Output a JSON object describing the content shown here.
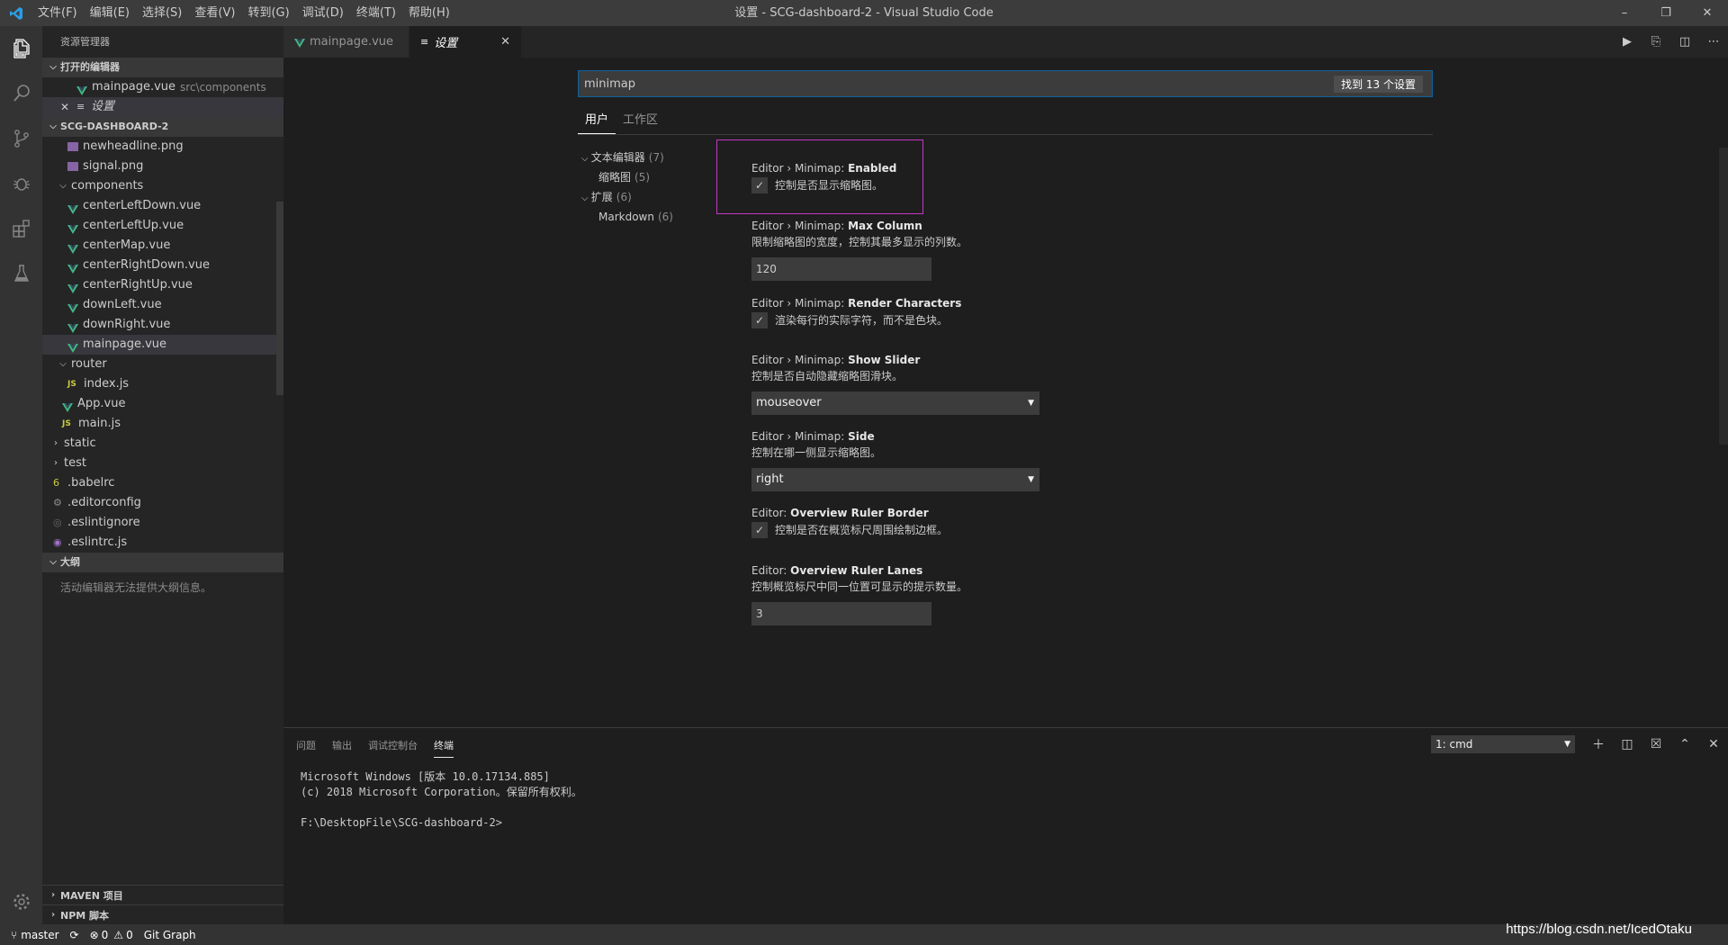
{
  "window": {
    "title": "设置 - SCG-dashboard-2 - Visual Studio Code",
    "menu": [
      "文件(F)",
      "编辑(E)",
      "选择(S)",
      "查看(V)",
      "转到(G)",
      "调试(D)",
      "终端(T)",
      "帮助(H)"
    ]
  },
  "sidebar": {
    "title": "资源管理器",
    "open_editors_title": "打开的编辑器",
    "open_editors": [
      {
        "name": "mainpage.vue",
        "desc": "src\\components"
      },
      {
        "name": "设置",
        "desc": ""
      }
    ],
    "project_title": "SCG-DASHBOARD-2",
    "files": [
      {
        "name": "newheadline.png",
        "type": "png",
        "indent": 2
      },
      {
        "name": "signal.png",
        "type": "png",
        "indent": 2
      },
      {
        "name": "components",
        "type": "folder-open",
        "indent": 1
      },
      {
        "name": "centerLeftDown.vue",
        "type": "vue",
        "indent": 2
      },
      {
        "name": "centerLeftUp.vue",
        "type": "vue",
        "indent": 2
      },
      {
        "name": "centerMap.vue",
        "type": "vue",
        "indent": 2
      },
      {
        "name": "centerRightDown.vue",
        "type": "vue",
        "indent": 2
      },
      {
        "name": "centerRightUp.vue",
        "type": "vue",
        "indent": 2
      },
      {
        "name": "downLeft.vue",
        "type": "vue",
        "indent": 2
      },
      {
        "name": "downRight.vue",
        "type": "vue",
        "indent": 2
      },
      {
        "name": "mainpage.vue",
        "type": "vue",
        "indent": 2,
        "selected": true
      },
      {
        "name": "router",
        "type": "folder-open",
        "indent": 1
      },
      {
        "name": "index.js",
        "type": "js",
        "indent": 2
      },
      {
        "name": "App.vue",
        "type": "vue",
        "indent": 1
      },
      {
        "name": "main.js",
        "type": "js",
        "indent": 1
      },
      {
        "name": "static",
        "type": "folder",
        "indent": 0
      },
      {
        "name": "test",
        "type": "folder",
        "indent": 0
      },
      {
        "name": ".babelrc",
        "type": "babel",
        "indent": 0
      },
      {
        "name": ".editorconfig",
        "type": "gear",
        "indent": 0
      },
      {
        "name": ".eslintignore",
        "type": "eslint",
        "indent": 0
      },
      {
        "name": ".eslintrc.js",
        "type": "eslintjs",
        "indent": 0
      }
    ],
    "outline_title": "大纲",
    "outline_empty": "活动编辑器无法提供大纲信息。",
    "maven_title": "MAVEN 项目",
    "npm_title": "NPM 脚本"
  },
  "tabs": [
    {
      "label": "mainpage.vue",
      "active": false
    },
    {
      "label": "设置",
      "active": true
    }
  ],
  "settings": {
    "search_value": "minimap",
    "search_count": "找到 13 个设置",
    "scope_tabs": [
      "用户",
      "工作区"
    ],
    "toc": [
      {
        "label": "文本编辑器",
        "count": "(7)",
        "level": 0
      },
      {
        "label": "缩略图",
        "count": "(5)",
        "level": 1
      },
      {
        "label": "扩展",
        "count": "(6)",
        "level": 0
      },
      {
        "label": "Markdown",
        "count": "(6)",
        "level": 1
      }
    ],
    "items": [
      {
        "prefix": "Editor › Minimap: ",
        "name": "Enabled",
        "check": "控制是否显示缩略图。"
      },
      {
        "prefix": "Editor › Minimap: ",
        "name": "Max Column",
        "desc": "限制缩略图的宽度，控制其最多显示的列数。",
        "input": "120"
      },
      {
        "prefix": "Editor › Minimap: ",
        "name": "Render Characters",
        "check": "渲染每行的实际字符，而不是色块。"
      },
      {
        "prefix": "Editor › Minimap: ",
        "name": "Show Slider",
        "desc": "控制是否自动隐藏缩略图滑块。",
        "select": "mouseover"
      },
      {
        "prefix": "Editor › Minimap: ",
        "name": "Side",
        "desc": "控制在哪一侧显示缩略图。",
        "select": "right"
      },
      {
        "prefix": "Editor: ",
        "name": "Overview Ruler Border",
        "check": "控制是否在概览标尺周围绘制边框。"
      },
      {
        "prefix": "Editor: ",
        "name": "Overview Ruler Lanes",
        "desc": "控制概览标尺中同一位置可显示的提示数量。",
        "input": "3"
      }
    ]
  },
  "panel": {
    "tabs": [
      "问题",
      "输出",
      "调试控制台",
      "终端"
    ],
    "terminal_select": "1: cmd",
    "terminal_lines": [
      "Microsoft Windows [版本 10.0.17134.885]",
      "(c) 2018 Microsoft Corporation。保留所有权利。",
      "",
      "F:\\DesktopFile\\SCG-dashboard-2>"
    ]
  },
  "statusbar": {
    "branch": "master",
    "errors": "0",
    "warnings": "0",
    "git_graph": "Git Graph",
    "watermark": "https://blog.csdn.net/IcedOtaku"
  },
  "colors": {
    "accent": "#0e639c",
    "highlight": "#c238c2",
    "vue": "#41b883"
  }
}
